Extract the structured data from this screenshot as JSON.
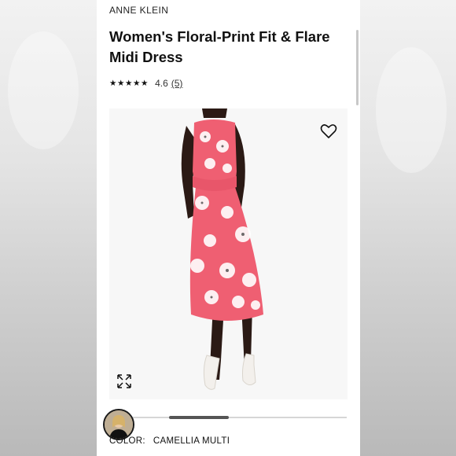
{
  "product": {
    "brand": "ANNE KLEIN",
    "title": "Women's Floral-Print Fit & Flare Midi Dress",
    "rating": {
      "stars": "★★★★★",
      "value": "4.6",
      "count": "(5)",
      "score": 4.6
    }
  },
  "color": {
    "label": "COLOR:",
    "value": "CAMELLIA MULTI"
  },
  "gallery": {
    "current_position_fraction": 0.2
  },
  "colors": {
    "dress": "#ef5f72",
    "skin": "#2b1a15",
    "shoe": "#f3f0ec"
  }
}
